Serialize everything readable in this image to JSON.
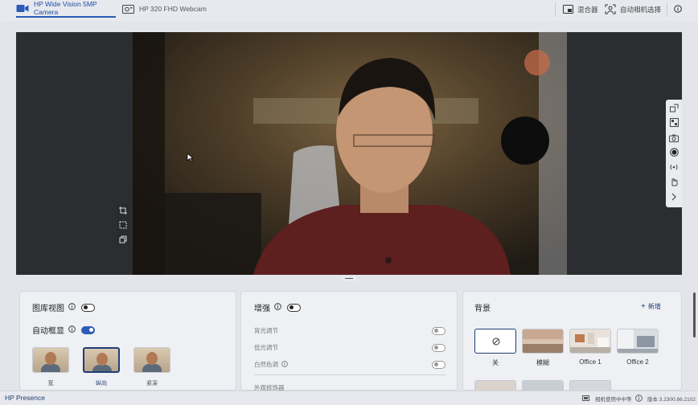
{
  "cameras": [
    {
      "label": "HP Wide Vision 5MP Camera",
      "active": true
    },
    {
      "label": "HP 320 FHD Webcam",
      "active": false
    }
  ],
  "toolbar": {
    "mixer_label": "混合器",
    "auto_camera_label": "自动相机选择"
  },
  "gallery": {
    "title": "图库视图",
    "auto_frame_title": "自动框显",
    "framing_options": [
      {
        "label": "宽",
        "active": false
      },
      {
        "label": "纵向",
        "active": true
      },
      {
        "label": "紧凑",
        "active": false
      }
    ]
  },
  "enhance": {
    "title": "增强",
    "rows": [
      {
        "label": "背光调节"
      },
      {
        "label": "低光调节"
      },
      {
        "label": "白然色调"
      }
    ],
    "more_label": "外观修饰器"
  },
  "background": {
    "title": "背景",
    "add_label": "新增",
    "options": [
      {
        "label": "关"
      },
      {
        "label": "模糊"
      },
      {
        "label": "Office 1"
      },
      {
        "label": "Office 2"
      }
    ]
  },
  "status": {
    "app_name": "HP Presence",
    "camera_in_use": "相机使用中中等",
    "version": "版本 3.2300.86.2102"
  },
  "colors": {
    "accent": "#2a5cb8",
    "dark_accent": "#1f3e75"
  }
}
